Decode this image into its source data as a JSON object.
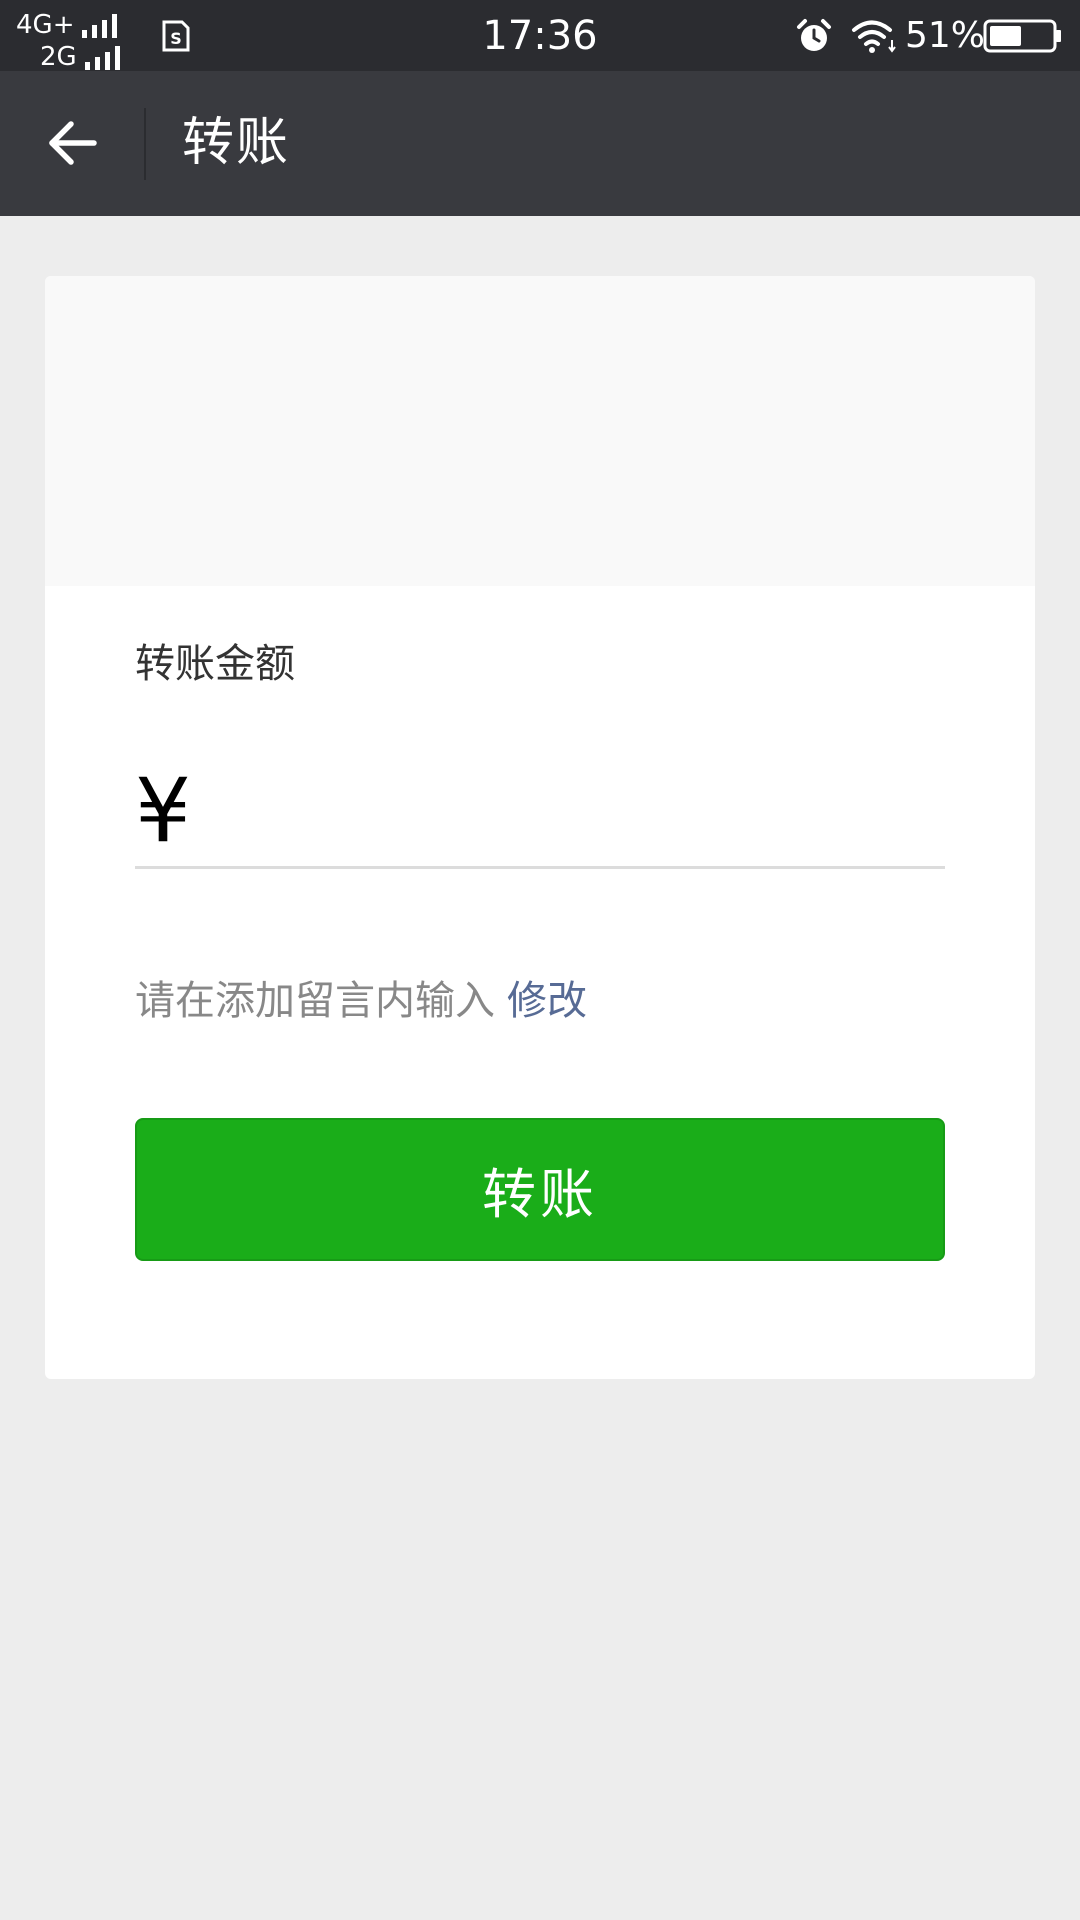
{
  "status_bar": {
    "network_primary": "4G+",
    "network_secondary": "2G",
    "time": "17:36",
    "battery_percent": "51%",
    "battery_level": 0.51,
    "icons": [
      "signal-icon",
      "sim-icon",
      "alarm-icon",
      "wifi-icon",
      "battery-icon"
    ]
  },
  "header": {
    "back_icon": "back-arrow-icon",
    "title": "转账"
  },
  "card": {
    "amount_label": "转账金额",
    "currency_symbol": "¥",
    "amount_value": "",
    "remark_text": "请在添加留言内输入",
    "remark_edit": "修改",
    "submit_label": "转账"
  },
  "colors": {
    "status_bar_bg": "#2b2c30",
    "nav_bar_bg": "#393a3f",
    "page_bg": "#ededed",
    "primary_button": "#1aad19",
    "link": "#576b95"
  }
}
